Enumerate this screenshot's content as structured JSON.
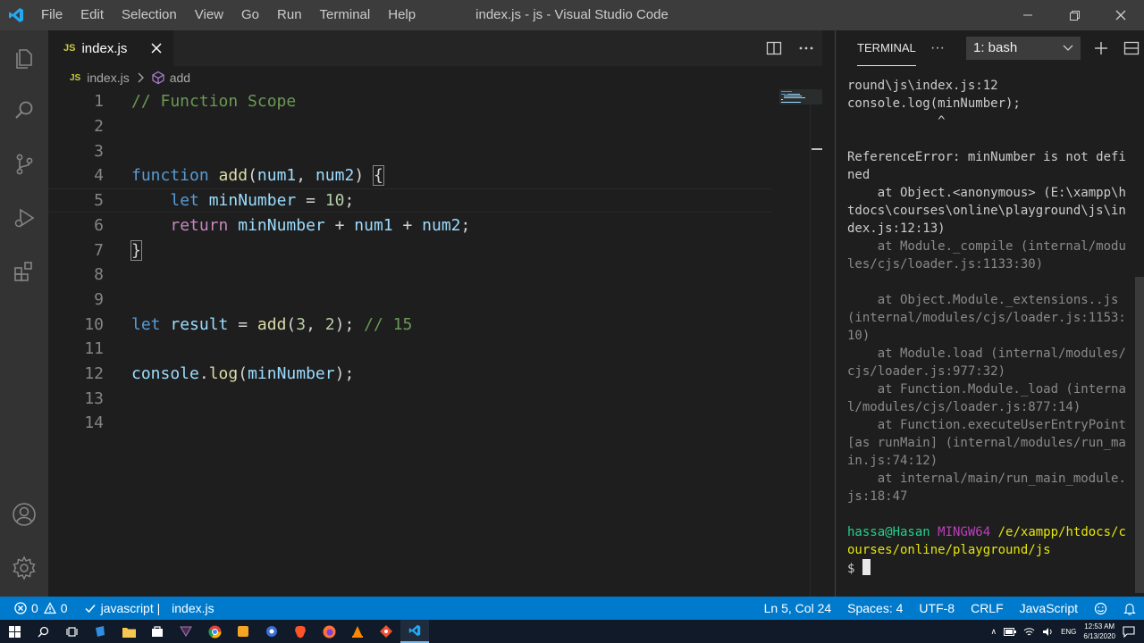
{
  "titlebar": {
    "menu": [
      "File",
      "Edit",
      "Selection",
      "View",
      "Go",
      "Run",
      "Terminal",
      "Help"
    ],
    "title": "index.js - js - Visual Studio Code"
  },
  "activity_bar": {
    "icons": [
      "files-icon",
      "search-icon",
      "source-control-icon",
      "run-debug-icon",
      "extensions-icon",
      "account-icon",
      "settings-gear-icon"
    ]
  },
  "tab": {
    "badge": "JS",
    "label": "index.js"
  },
  "breadcrumb": {
    "file_badge": "JS",
    "file": "index.js",
    "symbol": "add"
  },
  "editor": {
    "lines": [
      {
        "n": "1",
        "tokens": [
          {
            "t": "// Function Scope",
            "c": "comment"
          }
        ]
      },
      {
        "n": "2",
        "tokens": []
      },
      {
        "n": "3",
        "tokens": []
      },
      {
        "n": "4",
        "tokens": [
          {
            "t": "function",
            "c": "kw"
          },
          {
            "t": " ",
            "c": "pl"
          },
          {
            "t": "add",
            "c": "fn"
          },
          {
            "t": "(",
            "c": "pl"
          },
          {
            "t": "num1",
            "c": "var"
          },
          {
            "t": ", ",
            "c": "pl"
          },
          {
            "t": "num2",
            "c": "var"
          },
          {
            "t": ") ",
            "c": "pl"
          },
          {
            "t": "{",
            "c": "brace"
          }
        ]
      },
      {
        "n": "5",
        "tokens": [
          {
            "t": "    ",
            "c": "pl"
          },
          {
            "t": "let",
            "c": "kw"
          },
          {
            "t": " ",
            "c": "pl"
          },
          {
            "t": "minNumber",
            "c": "var"
          },
          {
            "t": " = ",
            "c": "pl"
          },
          {
            "t": "10",
            "c": "num"
          },
          {
            "t": ";",
            "c": "pl"
          }
        ]
      },
      {
        "n": "6",
        "tokens": [
          {
            "t": "    ",
            "c": "pl"
          },
          {
            "t": "return",
            "c": "kw2"
          },
          {
            "t": " ",
            "c": "pl"
          },
          {
            "t": "minNumber",
            "c": "var"
          },
          {
            "t": " + ",
            "c": "pl"
          },
          {
            "t": "num1",
            "c": "var"
          },
          {
            "t": " + ",
            "c": "pl"
          },
          {
            "t": "num2",
            "c": "var"
          },
          {
            "t": ";",
            "c": "pl"
          }
        ]
      },
      {
        "n": "7",
        "tokens": [
          {
            "t": "}",
            "c": "brace"
          }
        ]
      },
      {
        "n": "8",
        "tokens": []
      },
      {
        "n": "9",
        "tokens": []
      },
      {
        "n": "10",
        "tokens": [
          {
            "t": "let",
            "c": "kw"
          },
          {
            "t": " ",
            "c": "pl"
          },
          {
            "t": "result",
            "c": "var"
          },
          {
            "t": " = ",
            "c": "pl"
          },
          {
            "t": "add",
            "c": "fn"
          },
          {
            "t": "(",
            "c": "pl"
          },
          {
            "t": "3",
            "c": "num"
          },
          {
            "t": ", ",
            "c": "pl"
          },
          {
            "t": "2",
            "c": "num"
          },
          {
            "t": "); ",
            "c": "pl"
          },
          {
            "t": "// 15",
            "c": "comment"
          }
        ]
      },
      {
        "n": "11",
        "tokens": []
      },
      {
        "n": "12",
        "tokens": [
          {
            "t": "console",
            "c": "var"
          },
          {
            "t": ".",
            "c": "pl"
          },
          {
            "t": "log",
            "c": "fn"
          },
          {
            "t": "(",
            "c": "pl"
          },
          {
            "t": "minNumber",
            "c": "var"
          },
          {
            "t": ");",
            "c": "pl"
          }
        ]
      },
      {
        "n": "13",
        "tokens": []
      },
      {
        "n": "14",
        "tokens": []
      }
    ],
    "current_line": "5"
  },
  "panel": {
    "tab": "TERMINAL",
    "more": "···",
    "terminal_select": "1: bash",
    "output": [
      {
        "text": "round\\js\\index.js:12",
        "c": "norm"
      },
      {
        "text": "console.log(minNumber);",
        "c": "norm"
      },
      {
        "text": "            ^",
        "c": "norm"
      },
      {
        "text": "",
        "c": "norm"
      },
      {
        "text": "ReferenceError: minNumber is not defined",
        "c": "norm"
      },
      {
        "text": "    at Object.<anonymous> (E:\\xampp\\htdocs\\courses\\online\\playground\\js\\index.js:12:13)",
        "c": "norm"
      },
      {
        "text": "    at Module._compile (internal/modules/cjs/loader.js:1133:30)",
        "c": "dim"
      },
      {
        "text": "",
        "c": "norm"
      },
      {
        "text": "    at Object.Module._extensions..js (internal/modules/cjs/loader.js:1153:10)",
        "c": "dim"
      },
      {
        "text": "    at Module.load (internal/modules/cjs/loader.js:977:32)",
        "c": "dim"
      },
      {
        "text": "    at Function.Module._load (internal/modules/cjs/loader.js:877:14)",
        "c": "dim"
      },
      {
        "text": "    at Function.executeUserEntryPoint [as runMain] (internal/modules/run_main.js:74:12)",
        "c": "dim"
      },
      {
        "text": "    at internal/main/run_main_module.js:18:47",
        "c": "dim"
      },
      {
        "text": "",
        "c": "norm"
      }
    ],
    "prompt": {
      "user": "hassa@Hasan",
      "shell": "MINGW64",
      "path": "/e/xampp/htdocs/courses/online/playground/js",
      "symbol": "$"
    }
  },
  "statusbar": {
    "errors": "0",
    "warnings": "0",
    "lint": "javascript | ",
    "lint_file": "index.js",
    "position": "Ln 5, Col 24",
    "spaces": "Spaces: 4",
    "encoding": "UTF-8",
    "eol": "CRLF",
    "language": "JavaScript"
  },
  "taskbar": {
    "lang": "ENG",
    "time": "12:53 AM",
    "date": "6/13/2020"
  },
  "colors": {
    "accent": "#007acc",
    "titlebar": "#3c3c3c",
    "activitybar": "#333333",
    "editor_bg": "#1e1e1e"
  }
}
